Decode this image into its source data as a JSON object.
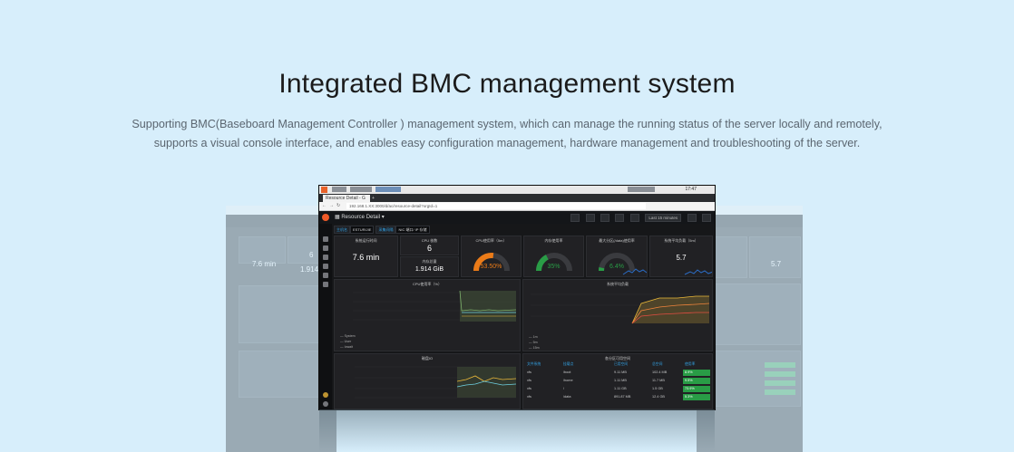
{
  "hero": {
    "title": "Integrated BMC management system",
    "line1": "Supporting BMC(Baseboard Management Controller ) management system, which can manage the running status of the server locally and remotely,",
    "line2": "supports a visual console interface, and enables easy configuration management, hardware management and troubleshooting of the server."
  },
  "colors": {
    "background": "#d7eefb",
    "dashboard_bg": "#161719",
    "panel_bg": "#212124",
    "accent_orange": "#f05a28",
    "gauge_orange": "#eb7b18",
    "gauge_green": "#299c46",
    "link_blue": "#33a2e5"
  },
  "browser": {
    "tab_title": "Resource Detail - G",
    "url": "192.168.1.XX:3000/d/ac/resource-detail?orgId=1",
    "clock": "17:47"
  },
  "dashboard": {
    "title": "Resource Detail",
    "time_range": "Last 15 minutes",
    "variables": [
      {
        "label": "主机名",
        "value": "ESTURIJIE"
      },
      {
        "label": "采集间隔",
        "value": "NIC 端口/ IP 存储"
      }
    ],
    "stats": {
      "uptime": {
        "title": "系统运行时间",
        "value": "7.6 min"
      },
      "cpu_cores": {
        "title": "CPU 核数",
        "value": "6"
      },
      "memory": {
        "title": "内存总量",
        "value": "1.914 GiB"
      }
    },
    "gauges": [
      {
        "title": "CPU使用率（5m）",
        "value": "53.50%",
        "percent": 53.5,
        "color": "#eb7b18"
      },
      {
        "title": "内存使用率",
        "value": "35%",
        "percent": 35,
        "color": "#299c46"
      },
      {
        "title": "最大分区(/data)使用率",
        "value": "6.4%",
        "percent": 6.4,
        "color": "#299c46"
      }
    ],
    "load_stat": {
      "title": "系统平均负载（5m）",
      "value": "5.7"
    },
    "charts": {
      "cpu": {
        "title": "CPU使用率（%）",
        "legend": [
          "System",
          "User",
          "Iowait",
          "Total"
        ]
      },
      "load": {
        "title": "系统平均负载",
        "legend": [
          "1m",
          "5m",
          "15m"
        ]
      },
      "disk_io": {
        "title": "磁盘IO"
      },
      "disk_space": {
        "title": "各分区可用空间"
      }
    },
    "partition_table": {
      "headers": [
        "文件系统",
        "挂载点",
        "已用空间",
        "总空间",
        "使用率"
      ],
      "rows": [
        [
          "xfs",
          "/boot",
          "9.11 MB",
          "102.4 MB",
          "8.9%"
        ],
        [
          "xfs",
          "/home",
          "1.11 MB",
          "11.7 MB",
          "9.5%"
        ],
        [
          "xfs",
          "/",
          "1.11 GB",
          "1.5 GB",
          "73.9%"
        ],
        [
          "xfs",
          "/data",
          "891.87 MB",
          "12.4 GB",
          "5.3%"
        ]
      ]
    }
  },
  "ghost_left": {
    "uptime": "7.6 min",
    "cores": "6",
    "memory": "1.914 G"
  },
  "ghost_right": {
    "load": "5.7"
  }
}
